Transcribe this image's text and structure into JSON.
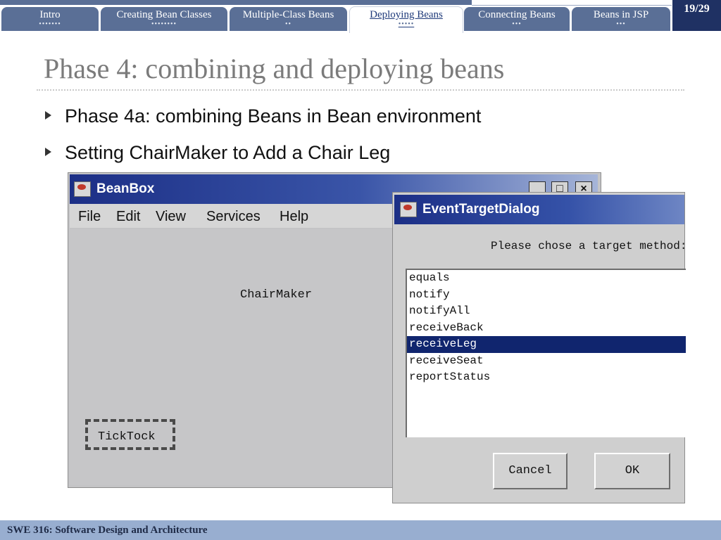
{
  "nav": {
    "tabs": [
      {
        "label": "Intro",
        "dots": "•••••••"
      },
      {
        "label": "Creating Bean Classes",
        "dots": "••••••••"
      },
      {
        "label": "Multiple-Class Beans",
        "dots": "••"
      },
      {
        "label": "Deploying Beans",
        "dots": "•••••"
      },
      {
        "label": "Connecting Beans",
        "dots": "•••"
      },
      {
        "label": "Beans in JSP",
        "dots": "•••"
      }
    ],
    "page_number": "19/29"
  },
  "slide": {
    "title": "Phase 4: combining and deploying beans",
    "bullets": [
      "Phase 4a: combining Beans in Bean environment",
      "Setting ChairMaker to Add a Chair Leg"
    ]
  },
  "beanbox": {
    "title": "BeanBox",
    "menu": [
      "File",
      "Edit",
      "View",
      "Services",
      "Help"
    ],
    "window_buttons": {
      "minimize": "_",
      "maximize": "□",
      "close": "×"
    },
    "beans": {
      "chairmaker": "ChairMaker",
      "ticktock": "TickTock"
    }
  },
  "dialog": {
    "title": "EventTargetDialog",
    "prompt": "Please chose a target method:",
    "methods": [
      "equals",
      "notify",
      "notifyAll",
      "receiveBack",
      "receiveLeg",
      "receiveSeat",
      "reportStatus"
    ],
    "selected": "receiveLeg",
    "cancel_label": "Cancel",
    "ok_label": "OK"
  },
  "footer": {
    "text": "SWE 316: Software Design and Architecture"
  },
  "colors": {
    "tab_bg": "#5a6f96",
    "page_no_bg": "#1f3163",
    "footer_bg": "#98aed0",
    "selection": "#10256e"
  }
}
